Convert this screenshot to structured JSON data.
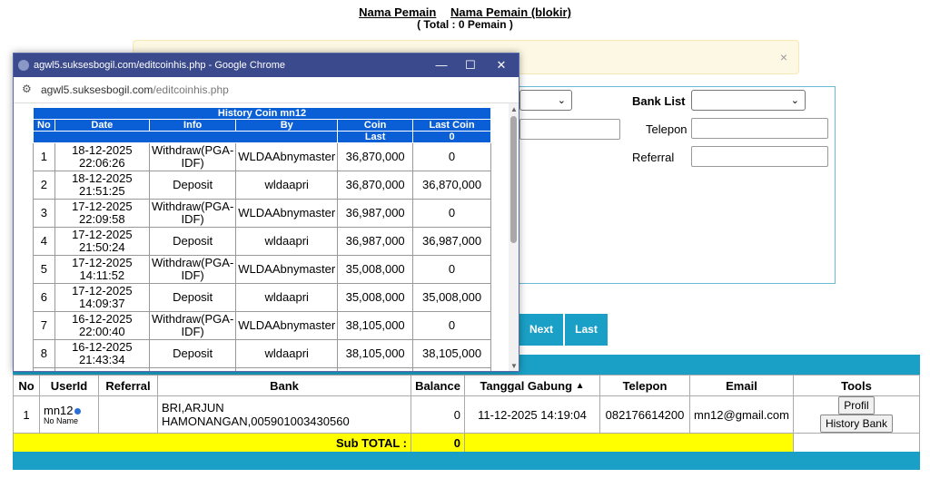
{
  "page": {
    "link_nama": "Nama Pemain",
    "link_blokir": "Nama Pemain (blokir)",
    "total_line": "( Total : 0 Pemain )",
    "alert_close": "×",
    "bank_list_label": "Bank List",
    "telepon_label": "Telepon",
    "referral_label": "Referral",
    "next_label": "Next",
    "last_label": "Last"
  },
  "table": {
    "headers": [
      "No",
      "UserId",
      "Referral",
      "Bank",
      "Balance",
      "Tanggal Gabung",
      "Telepon",
      "Email",
      "Tools"
    ],
    "sort_icon": "▲",
    "row": {
      "no": "1",
      "userid": "mn12",
      "name": "No Name",
      "referral": "",
      "bank": "BRI,ARJUN HAMONANGAN,005901003430560",
      "balance": "0",
      "tanggal": "11-12-2025 14:19:04",
      "telepon": "082176614200",
      "email": "mn12@gmail.com",
      "btn_profil": "Profil",
      "btn_history": "History Bank"
    },
    "subtotal_label": "Sub TOTAL :",
    "subtotal_value": "0"
  },
  "popup": {
    "window_title": "agwl5.suksesbogil.com/editcoinhis.php - Google Chrome",
    "url_host": "agwl5.suksesbogil.com",
    "url_path": "/editcoinhis.php",
    "table_title": "History Coin mn12",
    "headers": [
      "No",
      "Date",
      "Info",
      "By",
      "Coin",
      "Last Coin"
    ],
    "sub_headers": [
      "Last",
      "0"
    ],
    "rows": [
      {
        "no": "1",
        "date": "18-12-2025 22:06:26",
        "info": "Withdraw(PGA-IDF)",
        "by": "WLDAAbnymaster",
        "coin": "36,870,000",
        "last": "0"
      },
      {
        "no": "2",
        "date": "18-12-2025 21:51:25",
        "info": "Deposit",
        "by": "wldaapri",
        "coin": "36,870,000",
        "last": "36,870,000"
      },
      {
        "no": "3",
        "date": "17-12-2025 22:09:58",
        "info": "Withdraw(PGA-IDF)",
        "by": "WLDAAbnymaster",
        "coin": "36,987,000",
        "last": "0"
      },
      {
        "no": "4",
        "date": "17-12-2025 21:50:24",
        "info": "Deposit",
        "by": "wldaapri",
        "coin": "36,987,000",
        "last": "36,987,000"
      },
      {
        "no": "5",
        "date": "17-12-2025 14:11:52",
        "info": "Withdraw(PGA-IDF)",
        "by": "WLDAAbnymaster",
        "coin": "35,008,000",
        "last": "0"
      },
      {
        "no": "6",
        "date": "17-12-2025 14:09:37",
        "info": "Deposit",
        "by": "wldaapri",
        "coin": "35,008,000",
        "last": "35,008,000"
      },
      {
        "no": "7",
        "date": "16-12-2025 22:00:40",
        "info": "Withdraw(PGA-IDF)",
        "by": "WLDAAbnymaster",
        "coin": "38,105,000",
        "last": "0"
      },
      {
        "no": "8",
        "date": "16-12-2025 21:43:34",
        "info": "Deposit",
        "by": "wldaapri",
        "coin": "38,105,000",
        "last": "38,105,000"
      },
      {
        "no": "9",
        "date": "15-12-2025",
        "info": "Withdraw(PGA-",
        "by": "",
        "coin": "",
        "last": ""
      }
    ]
  },
  "colors": {
    "accent": "#1aa0c6",
    "titlebar": "#3b4a8c",
    "header_blue": "#0b5fd6",
    "subtotal": "#ffff00"
  }
}
